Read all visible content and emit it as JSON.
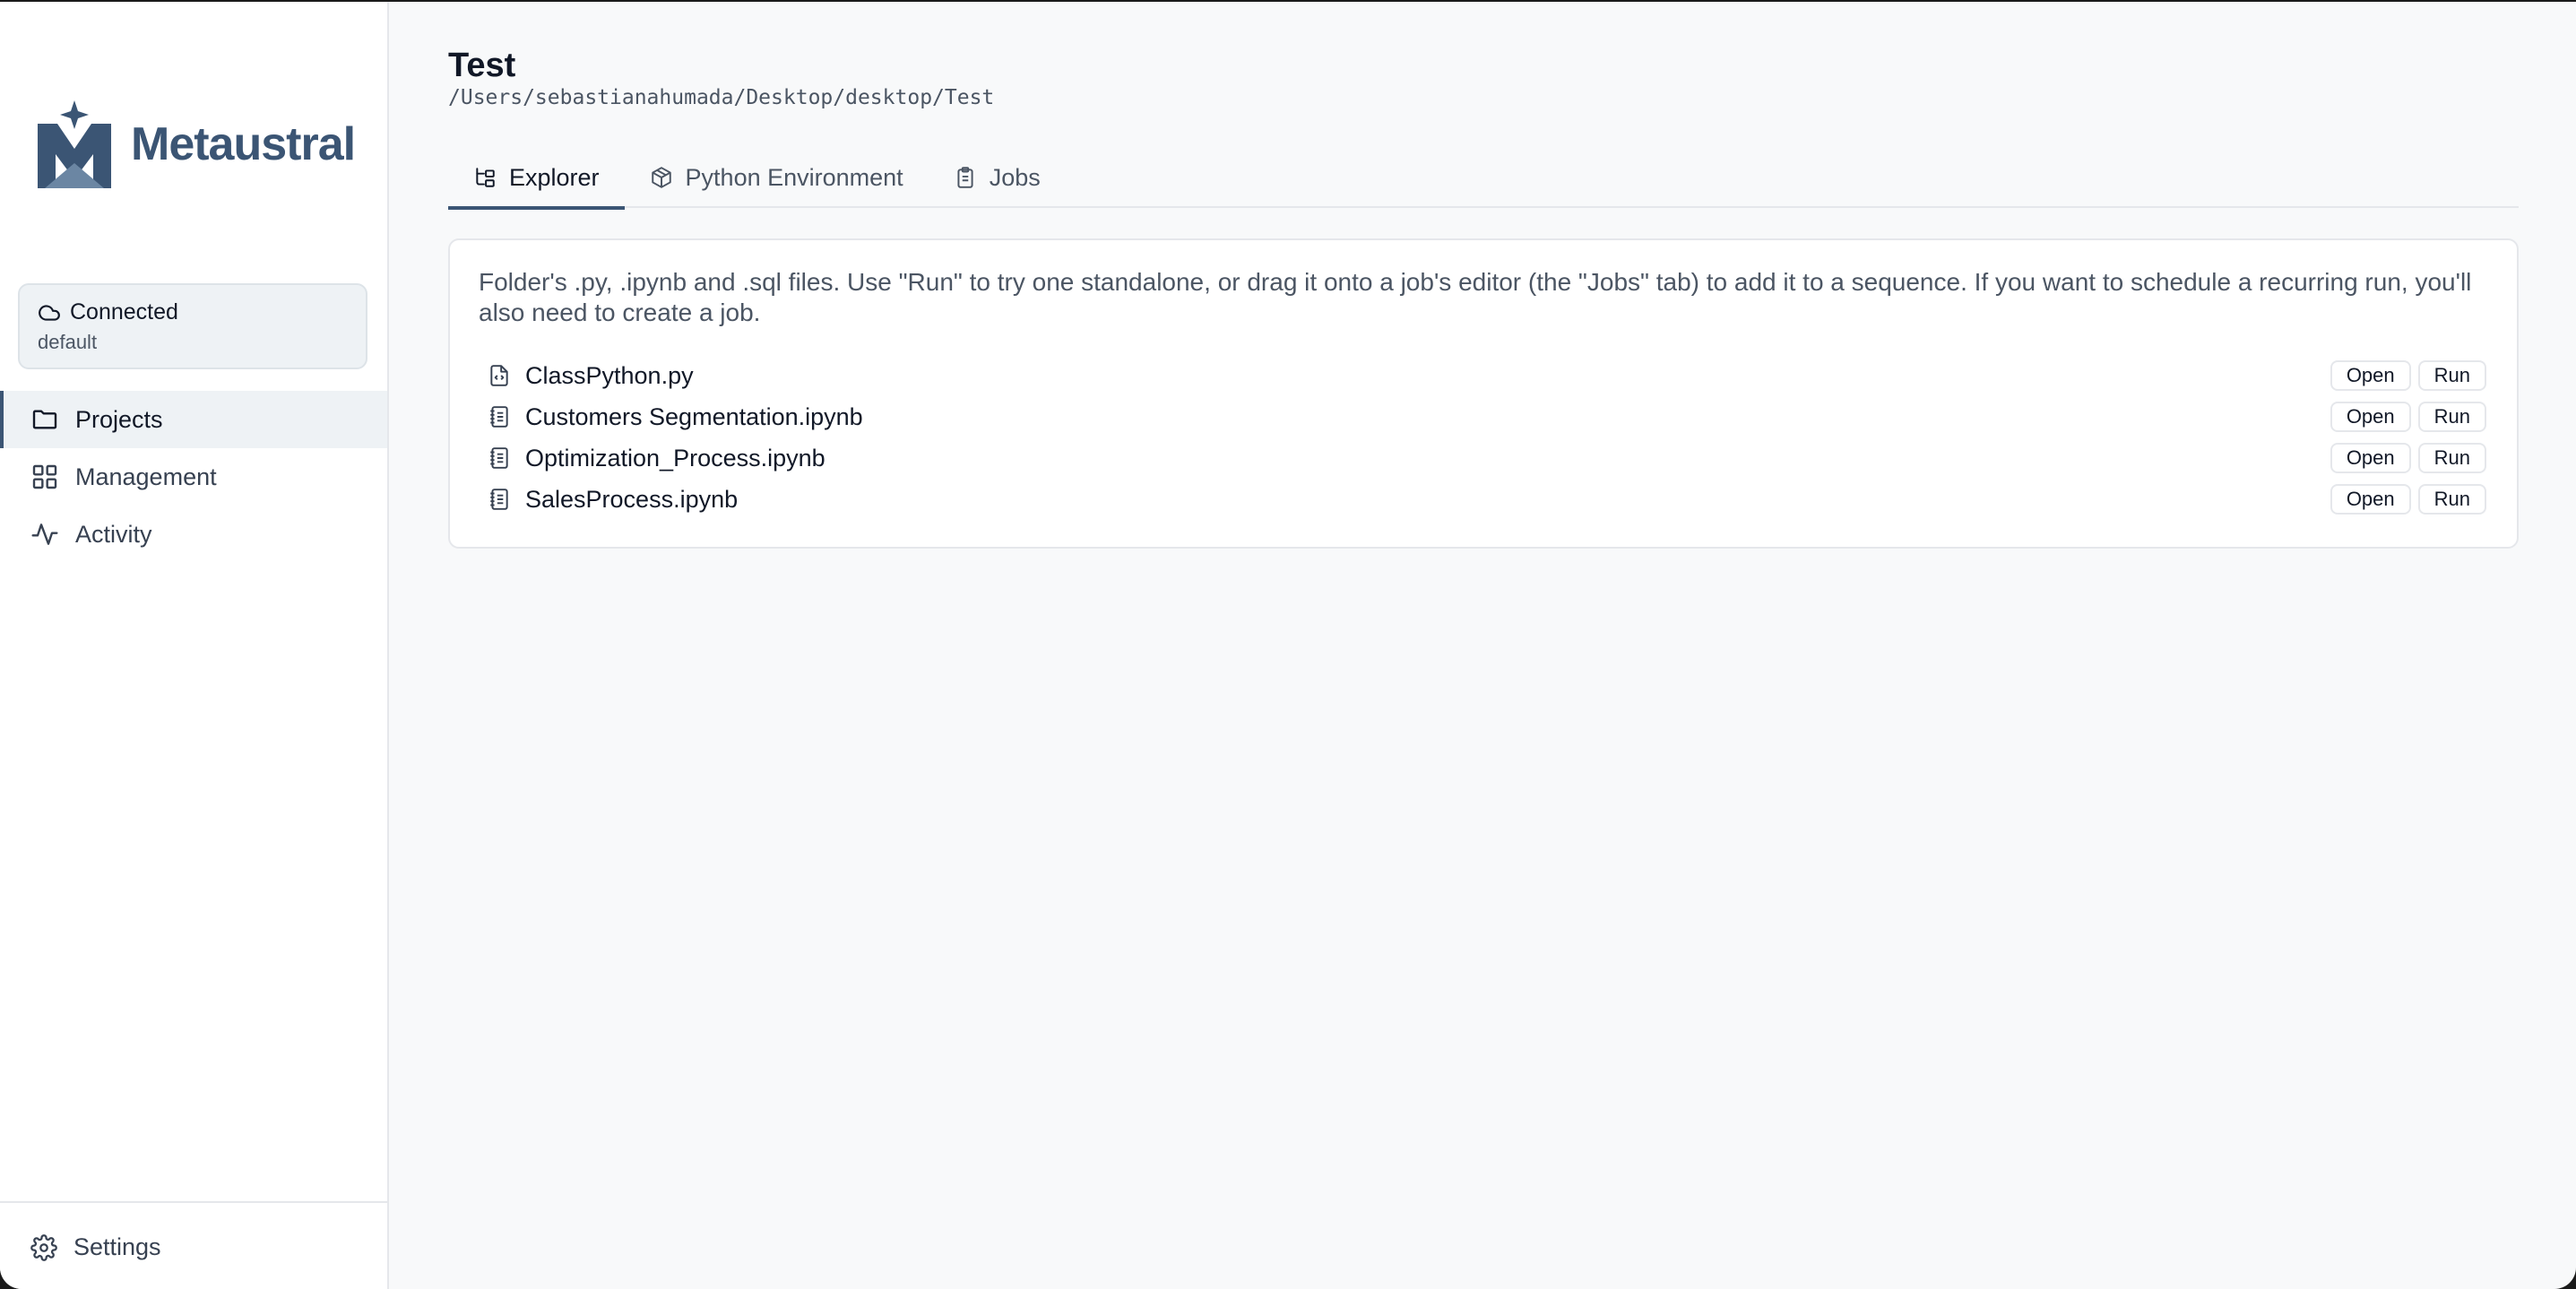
{
  "brand": {
    "name": "Metaustral",
    "color": "#3b5574"
  },
  "connection": {
    "status": "Connected",
    "profile": "default"
  },
  "sidebar": {
    "items": [
      {
        "label": "Projects",
        "icon": "folder-icon",
        "active": true
      },
      {
        "label": "Management",
        "icon": "grid-icon",
        "active": false
      },
      {
        "label": "Activity",
        "icon": "activity-icon",
        "active": false
      }
    ],
    "settings_label": "Settings"
  },
  "project": {
    "title": "Test",
    "path": "/Users/sebastianahumada/Desktop/desktop/Test"
  },
  "tabs": [
    {
      "label": "Explorer",
      "icon": "tree-icon",
      "active": true
    },
    {
      "label": "Python Environment",
      "icon": "package-icon",
      "active": false
    },
    {
      "label": "Jobs",
      "icon": "clipboard-icon",
      "active": false
    }
  ],
  "explorer": {
    "description": "Folder's .py, .ipynb and .sql files. Use \"Run\" to try one standalone, or drag it onto a job's editor (the \"Jobs\" tab) to add it to a sequence. If you want to schedule a recurring run, you'll also need to create a job.",
    "files": [
      {
        "name": "ClassPython.py",
        "icon": "file-code-icon"
      },
      {
        "name": "Customers Segmentation.ipynb",
        "icon": "notebook-icon"
      },
      {
        "name": "Optimization_Process.ipynb",
        "icon": "notebook-icon"
      },
      {
        "name": "SalesProcess.ipynb",
        "icon": "notebook-icon"
      }
    ],
    "open_label": "Open",
    "run_label": "Run"
  }
}
